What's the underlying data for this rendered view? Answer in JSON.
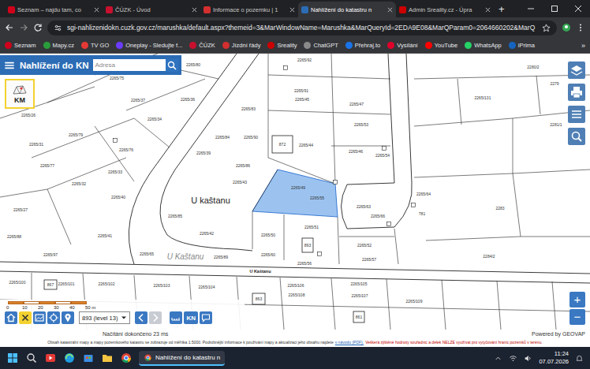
{
  "browser": {
    "tabs": [
      {
        "label": "Seznam – najdu tam, co",
        "selected": false,
        "color": "#d0021b"
      },
      {
        "label": "ČÚZK - Úvod",
        "selected": false,
        "color": "#c8102e"
      },
      {
        "label": "Informace o pozemku | 1",
        "selected": false,
        "color": "#d32f2f"
      },
      {
        "label": "Nahlížení do katastru n",
        "selected": true,
        "color": "#2b6cb5"
      },
      {
        "label": "Admin Sreality.cz - Úpra",
        "selected": false,
        "color": "#cc0000"
      }
    ],
    "new_tab": "+",
    "url": "sgi-nahlizenidokn.cuzk.gov.cz/marushka/default.aspx?themeid=3&MarWindowName=Marushka&MarQueryId=2EDA9E08&MarQParam0=2064660202&MarQ",
    "bookmarks": [
      {
        "label": "Seznam",
        "color": "#d0021b"
      },
      {
        "label": "Mapy.cz",
        "color": "#2a9d3b"
      },
      {
        "label": "TV GO",
        "color": "#e53935"
      },
      {
        "label": "Oneplay - Sledujte f...",
        "color": "#6b3cff"
      },
      {
        "label": "ČÚZK",
        "color": "#c8102e"
      },
      {
        "label": "Jízdní řády",
        "color": "#d32f2f"
      },
      {
        "label": "Sreality",
        "color": "#cc0000"
      },
      {
        "label": "ChatGPT",
        "color": "#8a8a8a"
      },
      {
        "label": "Přehraj.to",
        "color": "#1a73e8"
      },
      {
        "label": "Vysílání",
        "color": "#e0002a"
      },
      {
        "label": "YouTube",
        "color": "#ff0000"
      },
      {
        "label": "WhatsApp",
        "color": "#25d366"
      },
      {
        "label": "iPrima",
        "color": "#1565c0"
      }
    ],
    "more_bookmarks": "»"
  },
  "app": {
    "title": "Nahlížení do KN",
    "search_placeholder": "Adresa",
    "km_button": "KM"
  },
  "map": {
    "parcel_labels": [
      "2265/80",
      "2265/92",
      "2280/2",
      "2279",
      "2265/75",
      "2265/37",
      "2265/36",
      "2265/91",
      "2265/45",
      "2265/47",
      "2265/131",
      "2281/1",
      "2265/26",
      "2265/83",
      "2265/34",
      "2265/53",
      "2265/84",
      "2265/90",
      "2265/44",
      "2265/46",
      "2265/54",
      "2265/79",
      "2265/31",
      "2265/77",
      "2265/76",
      "2265/39",
      "2265/86",
      "2265/33",
      "2265/43",
      "2265/49",
      "2265/55",
      "2265/64",
      "2265/40",
      "2265/32",
      "2265/85",
      "2265/63",
      "2265/66",
      "781",
      "2283",
      "2265/41",
      "2265/88",
      "2265/42",
      "2265/50",
      "2265/51",
      "2265/52",
      "2265/65",
      "2265/89",
      "2265/57",
      "2265/56",
      "2265/97",
      "2284/2",
      "2265/60",
      "2265/27",
      "2265/100",
      "2265/101",
      "2265/102",
      "2265/103",
      "2265/104",
      "2265/105",
      "2265/106",
      "2265/108",
      "2265/107",
      "2265/109"
    ],
    "building_labels": [
      "872",
      "893",
      "863",
      "861",
      "867"
    ],
    "street_labels": [
      "U kaštanu",
      "U Kaštanu",
      "U Kaštanu"
    ],
    "selected_parcel_highlighted": true,
    "scale": [
      "0",
      "10",
      "20",
      "30",
      "40",
      "50 m"
    ],
    "level_select": "893 (level 13)",
    "back_disabled": false,
    "forward_disabled": true,
    "kn_button": "KN",
    "zoom_in": "+",
    "zoom_out": "−"
  },
  "status": {
    "loading": "Načítání dokončeno 23 ms",
    "powered_by": "Powered by GEOVAP"
  },
  "footer": {
    "text": "Obsah katastrální mapy a mapy pozemkového katastru se zobrazuje od měřítka 1:5000. Podrobnější informace k používání mapy a aktualizaci jeho obsahu najdete",
    "link": "v návodu (PDF).",
    "warning": "Veškerá zjištěné hodnoty souřadnic a délek NELZE využívat pro vytyčování hranic pozemků v terénu."
  },
  "taskbar": {
    "app": "Nahlížení do katastru n",
    "app_selected": true,
    "time": "11:24",
    "date": "07.07.2026"
  }
}
